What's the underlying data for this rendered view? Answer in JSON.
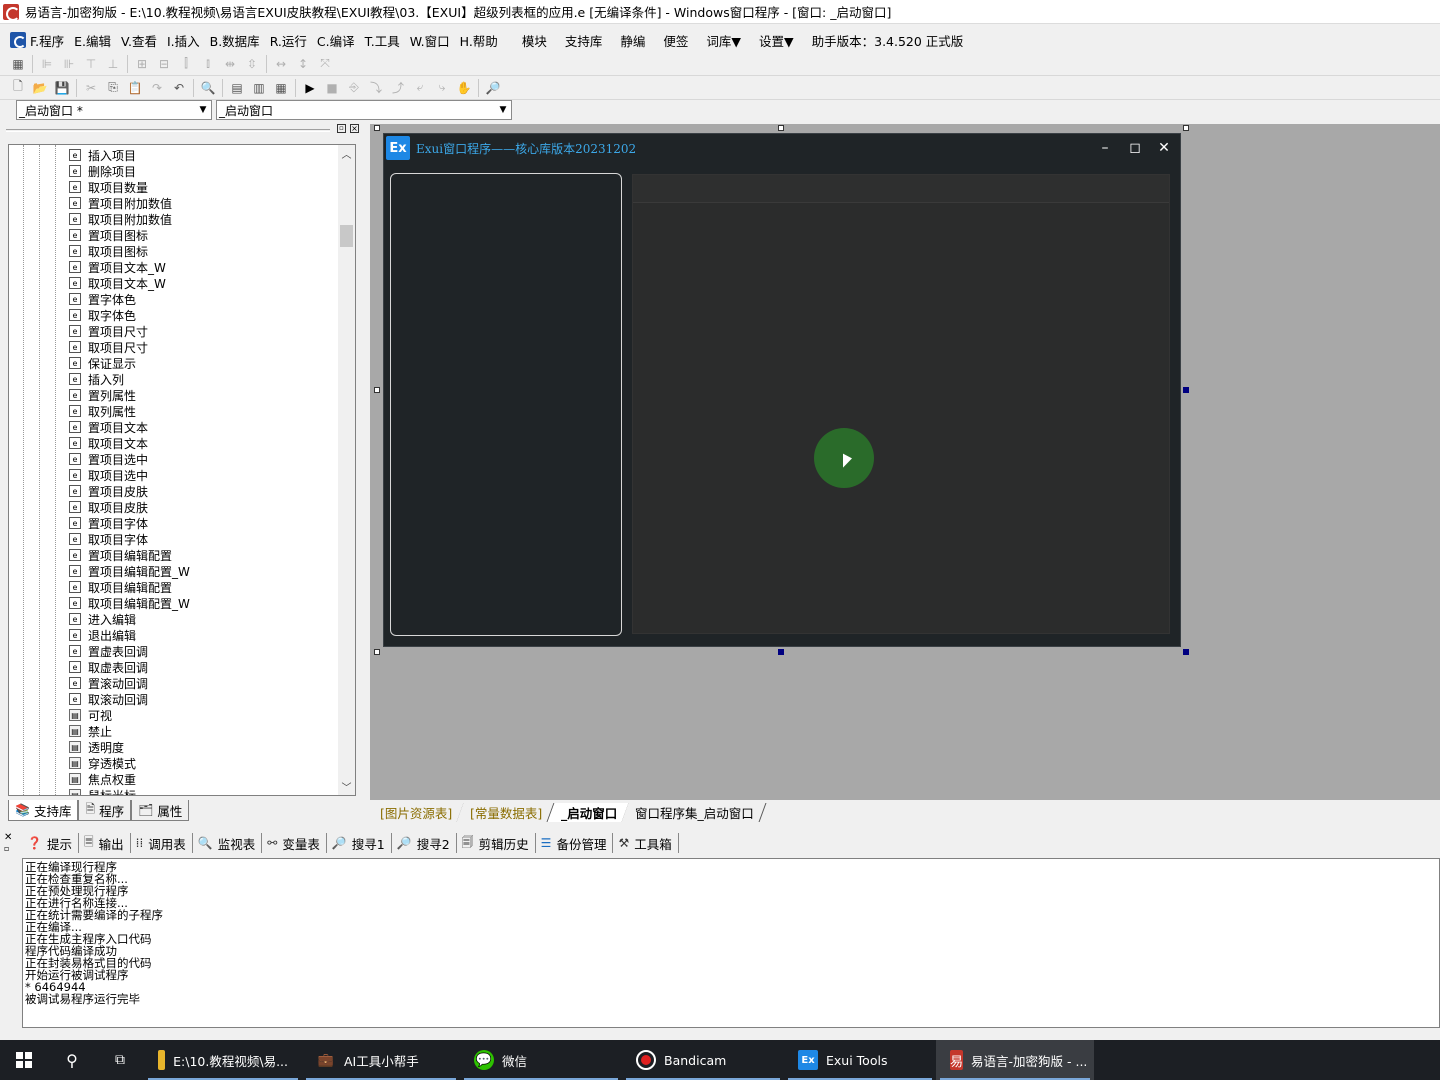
{
  "window": {
    "title": "易语言-加密狗版 - E:\\10.教程视频\\易语言EXUI皮肤教程\\EXUI教程\\03.【EXUI】超级列表框的应用.e [无编译条件] - Windows窗口程序 - [窗口: _启动窗口]"
  },
  "menu": {
    "items": [
      "F.程序",
      "E.编辑",
      "V.查看",
      "I.插入",
      "B.数据库",
      "R.运行",
      "C.编译",
      "T.工具",
      "W.窗口",
      "H.帮助"
    ],
    "extra": [
      "模块",
      "支持库",
      "静编",
      "便签",
      "词库▼",
      "设置▼"
    ],
    "version": "助手版本：3.4.520 正式版"
  },
  "combos": {
    "window_select": "_启动窗口 *",
    "event_select": "_启动窗口"
  },
  "tree": {
    "items": [
      {
        "label": "插入项目",
        "kind": "method"
      },
      {
        "label": "删除项目",
        "kind": "method"
      },
      {
        "label": "取项目数量",
        "kind": "method"
      },
      {
        "label": "置项目附加数值",
        "kind": "method"
      },
      {
        "label": "取项目附加数值",
        "kind": "method"
      },
      {
        "label": "置项目图标",
        "kind": "method"
      },
      {
        "label": "取项目图标",
        "kind": "method"
      },
      {
        "label": "置项目文本_W",
        "kind": "method"
      },
      {
        "label": "取项目文本_W",
        "kind": "method"
      },
      {
        "label": "置字体色",
        "kind": "method"
      },
      {
        "label": "取字体色",
        "kind": "method"
      },
      {
        "label": "置项目尺寸",
        "kind": "method"
      },
      {
        "label": "取项目尺寸",
        "kind": "method"
      },
      {
        "label": "保证显示",
        "kind": "method"
      },
      {
        "label": "插入列",
        "kind": "method"
      },
      {
        "label": "置列属性",
        "kind": "method"
      },
      {
        "label": "取列属性",
        "kind": "method"
      },
      {
        "label": "置项目文本",
        "kind": "method"
      },
      {
        "label": "取项目文本",
        "kind": "method"
      },
      {
        "label": "置项目选中",
        "kind": "method"
      },
      {
        "label": "取项目选中",
        "kind": "method"
      },
      {
        "label": "置项目皮肤",
        "kind": "method"
      },
      {
        "label": "取项目皮肤",
        "kind": "method"
      },
      {
        "label": "置项目字体",
        "kind": "method"
      },
      {
        "label": "取项目字体",
        "kind": "method"
      },
      {
        "label": "置项目编辑配置",
        "kind": "method"
      },
      {
        "label": "置项目编辑配置_W",
        "kind": "method"
      },
      {
        "label": "取项目编辑配置",
        "kind": "method"
      },
      {
        "label": "取项目编辑配置_W",
        "kind": "method"
      },
      {
        "label": "进入编辑",
        "kind": "method"
      },
      {
        "label": "退出编辑",
        "kind": "method"
      },
      {
        "label": "置虚表回调",
        "kind": "method"
      },
      {
        "label": "取虚表回调",
        "kind": "method"
      },
      {
        "label": "置滚动回调",
        "kind": "method"
      },
      {
        "label": "取滚动回调",
        "kind": "method"
      },
      {
        "label": "可视",
        "kind": "prop"
      },
      {
        "label": "禁止",
        "kind": "prop"
      },
      {
        "label": "透明度",
        "kind": "prop"
      },
      {
        "label": "穿透模式",
        "kind": "prop"
      },
      {
        "label": "焦点权重",
        "kind": "prop"
      },
      {
        "label": "鼠标光标",
        "kind": "prop"
      }
    ]
  },
  "left_tabs": [
    "支持库",
    "程序",
    "属性"
  ],
  "exui": {
    "logo": "Ex",
    "title": "Exui窗口程序——核心库版本20231202"
  },
  "doc_tabs": [
    "[图片资源表]",
    "[常量数据表]",
    "_启动窗口",
    "窗口程序集_启动窗口"
  ],
  "output_tabs": [
    "提示",
    "输出",
    "调用表",
    "监视表",
    "变量表",
    "搜寻1",
    "搜寻2",
    "剪辑历史",
    "备份管理",
    "工具箱"
  ],
  "output_lines": [
    "正在编译现行程序",
    "正在检查重复名称...",
    "正在预处理现行程序",
    "正在进行名称连接...",
    "正在统计需要编译的子程序",
    "正在编译...",
    "正在生成主程序入口代码",
    "程序代码编译成功",
    "正在封装易格式目的代码",
    "开始运行被调试程序",
    "* 6464944",
    "被调试易程序运行完毕"
  ],
  "taskbar": {
    "apps": [
      {
        "label": "E:\\10.教程视频\\易...",
        "icon": "folder-icon"
      },
      {
        "label": "AI工具小帮手",
        "icon": "briefcase-icon"
      },
      {
        "label": "微信",
        "icon": "wechat-icon"
      },
      {
        "label": "Bandicam",
        "icon": "record-icon"
      },
      {
        "label": "Exui Tools",
        "icon": "exui-icon"
      },
      {
        "label": "易语言-加密狗版 - ...",
        "icon": "eyuyan-icon"
      }
    ]
  },
  "colors": {
    "exui_title": "#3ca8e8",
    "exui_bg": "#1f2427",
    "designer_bg": "#a8a8a8",
    "taskbar_bg": "#1c1f24"
  }
}
